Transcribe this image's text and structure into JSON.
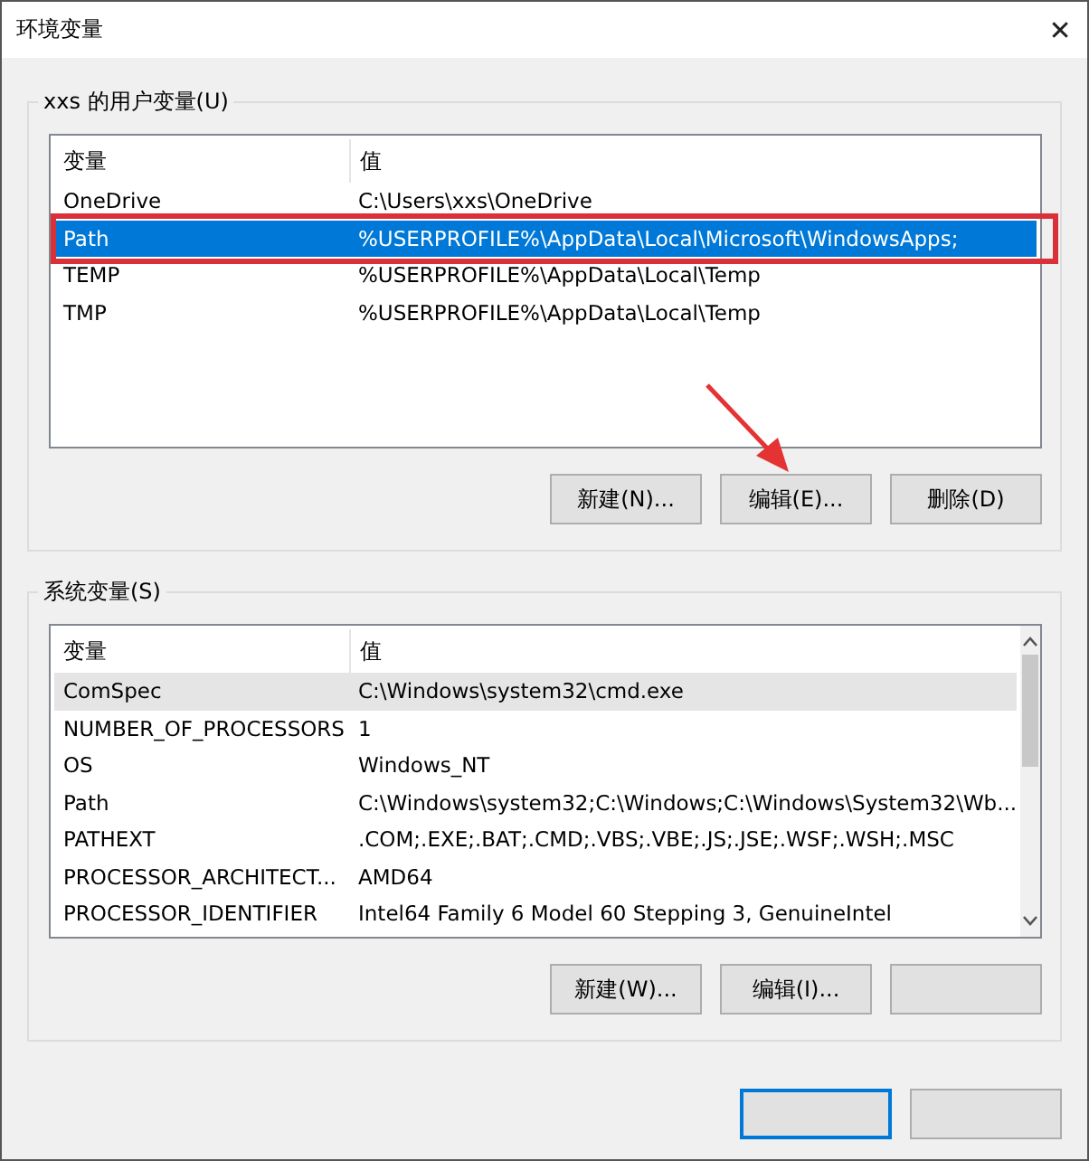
{
  "window": {
    "title": "环境变量",
    "close": "✕"
  },
  "user_variables": {
    "title": "xxs 的用户变量(U)",
    "focused": true,
    "columns": [
      "变量",
      "值"
    ],
    "rows": [
      {
        "name": "OneDrive",
        "value": "C:\\Users\\xxs\\OneDrive",
        "selected": false,
        "highlighted": false
      },
      {
        "name": "Path",
        "value": "%USERPROFILE%\\AppData\\Local\\Microsoft\\WindowsApps;",
        "selected": true,
        "highlighted": true
      },
      {
        "name": "TEMP",
        "value": "%USERPROFILE%\\AppData\\Local\\Temp",
        "selected": false,
        "highlighted": false
      },
      {
        "name": "TMP",
        "value": "%USERPROFILE%\\AppData\\Local\\Temp",
        "selected": false,
        "highlighted": false
      }
    ],
    "buttons": [
      {
        "label": "新建(N)...",
        "pointed": false
      },
      {
        "label": "编辑(E)...",
        "pointed": true
      },
      {
        "label": "删除(D)",
        "pointed": false
      }
    ]
  },
  "system_variables": {
    "title": "系统变量(S)",
    "focused": false,
    "columns": [
      "变量",
      "值"
    ],
    "rows": [
      {
        "name": "ComSpec",
        "value": "C:\\Windows\\system32\\cmd.exe",
        "selected": true,
        "highlighted": false
      },
      {
        "name": "NUMBER_OF_PROCESSORS",
        "value": "1",
        "selected": false,
        "highlighted": false
      },
      {
        "name": "OS",
        "value": "Windows_NT",
        "selected": false,
        "highlighted": false
      },
      {
        "name": "Path",
        "value": "C:\\Windows\\system32;C:\\Windows;C:\\Windows\\System32\\Wb...",
        "selected": false,
        "highlighted": false
      },
      {
        "name": "PATHEXT",
        "value": ".COM;.EXE;.BAT;.CMD;.VBS;.VBE;.JS;.JSE;.WSF;.WSH;.MSC",
        "selected": false,
        "highlighted": false
      },
      {
        "name": "PROCESSOR_ARCHITECT...",
        "value": "AMD64",
        "selected": false,
        "highlighted": false
      },
      {
        "name": "PROCESSOR_IDENTIFIER",
        "value": "Intel64 Family 6 Model 60 Stepping 3, GenuineIntel",
        "selected": false,
        "highlighted": false
      }
    ],
    "buttons": [
      {
        "label": "新建(W)...",
        "pointed": false
      },
      {
        "label": "编辑(I)...",
        "pointed": false
      }
    ]
  }
}
